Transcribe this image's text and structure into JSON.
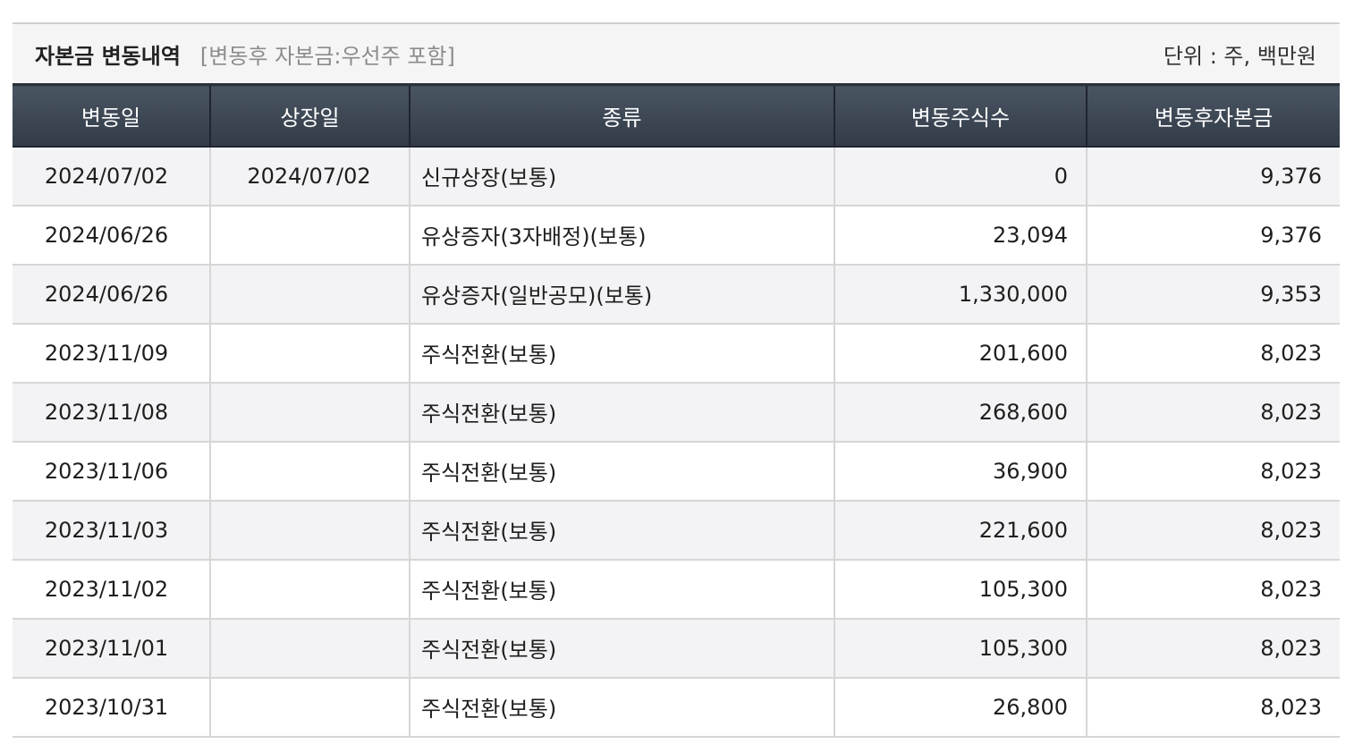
{
  "header": {
    "title": "자본금 변동내역",
    "subtitle": "[변동후 자본금:우선주 포함]",
    "unit": "단위 : 주, 백만원"
  },
  "table": {
    "columns": [
      "변동일",
      "상장일",
      "종류",
      "변동주식수",
      "변동후자본금"
    ],
    "rows": [
      {
        "date": "2024/07/02",
        "listing_date": "2024/07/02",
        "type": "신규상장(보통)",
        "shares": "0",
        "capital": "9,376"
      },
      {
        "date": "2024/06/26",
        "listing_date": "",
        "type": "유상증자(3자배정)(보통)",
        "shares": "23,094",
        "capital": "9,376"
      },
      {
        "date": "2024/06/26",
        "listing_date": "",
        "type": "유상증자(일반공모)(보통)",
        "shares": "1,330,000",
        "capital": "9,353"
      },
      {
        "date": "2023/11/09",
        "listing_date": "",
        "type": "주식전환(보통)",
        "shares": "201,600",
        "capital": "8,023"
      },
      {
        "date": "2023/11/08",
        "listing_date": "",
        "type": "주식전환(보통)",
        "shares": "268,600",
        "capital": "8,023"
      },
      {
        "date": "2023/11/06",
        "listing_date": "",
        "type": "주식전환(보통)",
        "shares": "36,900",
        "capital": "8,023"
      },
      {
        "date": "2023/11/03",
        "listing_date": "",
        "type": "주식전환(보통)",
        "shares": "221,600",
        "capital": "8,023"
      },
      {
        "date": "2023/11/02",
        "listing_date": "",
        "type": "주식전환(보통)",
        "shares": "105,300",
        "capital": "8,023"
      },
      {
        "date": "2023/11/01",
        "listing_date": "",
        "type": "주식전환(보통)",
        "shares": "105,300",
        "capital": "8,023"
      },
      {
        "date": "2023/10/31",
        "listing_date": "",
        "type": "주식전환(보통)",
        "shares": "26,800",
        "capital": "8,023"
      }
    ]
  }
}
